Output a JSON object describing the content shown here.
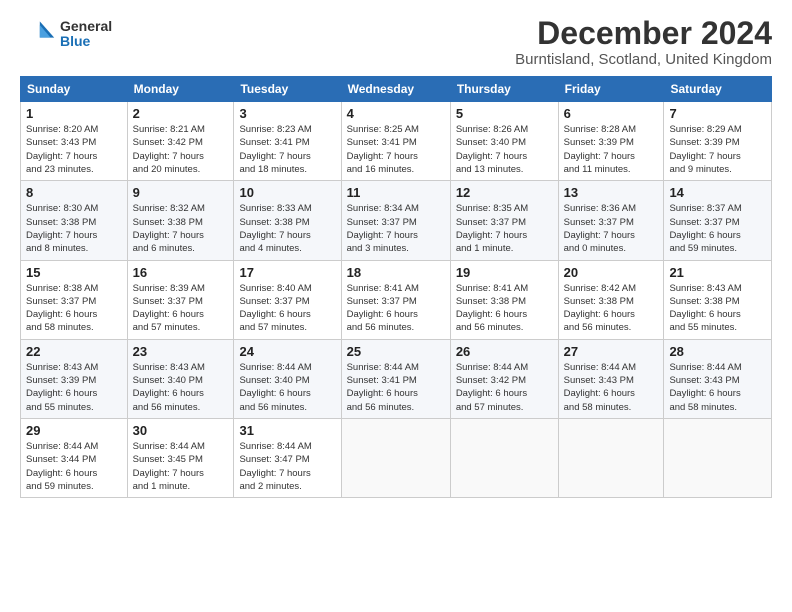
{
  "logo": {
    "general": "General",
    "blue": "Blue"
  },
  "title": "December 2024",
  "subtitle": "Burntisland, Scotland, United Kingdom",
  "headers": [
    "Sunday",
    "Monday",
    "Tuesday",
    "Wednesday",
    "Thursday",
    "Friday",
    "Saturday"
  ],
  "weeks": [
    [
      {
        "day": "1",
        "info": "Sunrise: 8:20 AM\nSunset: 3:43 PM\nDaylight: 7 hours\nand 23 minutes."
      },
      {
        "day": "2",
        "info": "Sunrise: 8:21 AM\nSunset: 3:42 PM\nDaylight: 7 hours\nand 20 minutes."
      },
      {
        "day": "3",
        "info": "Sunrise: 8:23 AM\nSunset: 3:41 PM\nDaylight: 7 hours\nand 18 minutes."
      },
      {
        "day": "4",
        "info": "Sunrise: 8:25 AM\nSunset: 3:41 PM\nDaylight: 7 hours\nand 16 minutes."
      },
      {
        "day": "5",
        "info": "Sunrise: 8:26 AM\nSunset: 3:40 PM\nDaylight: 7 hours\nand 13 minutes."
      },
      {
        "day": "6",
        "info": "Sunrise: 8:28 AM\nSunset: 3:39 PM\nDaylight: 7 hours\nand 11 minutes."
      },
      {
        "day": "7",
        "info": "Sunrise: 8:29 AM\nSunset: 3:39 PM\nDaylight: 7 hours\nand 9 minutes."
      }
    ],
    [
      {
        "day": "8",
        "info": "Sunrise: 8:30 AM\nSunset: 3:38 PM\nDaylight: 7 hours\nand 8 minutes."
      },
      {
        "day": "9",
        "info": "Sunrise: 8:32 AM\nSunset: 3:38 PM\nDaylight: 7 hours\nand 6 minutes."
      },
      {
        "day": "10",
        "info": "Sunrise: 8:33 AM\nSunset: 3:38 PM\nDaylight: 7 hours\nand 4 minutes."
      },
      {
        "day": "11",
        "info": "Sunrise: 8:34 AM\nSunset: 3:37 PM\nDaylight: 7 hours\nand 3 minutes."
      },
      {
        "day": "12",
        "info": "Sunrise: 8:35 AM\nSunset: 3:37 PM\nDaylight: 7 hours\nand 1 minute."
      },
      {
        "day": "13",
        "info": "Sunrise: 8:36 AM\nSunset: 3:37 PM\nDaylight: 7 hours\nand 0 minutes."
      },
      {
        "day": "14",
        "info": "Sunrise: 8:37 AM\nSunset: 3:37 PM\nDaylight: 6 hours\nand 59 minutes."
      }
    ],
    [
      {
        "day": "15",
        "info": "Sunrise: 8:38 AM\nSunset: 3:37 PM\nDaylight: 6 hours\nand 58 minutes."
      },
      {
        "day": "16",
        "info": "Sunrise: 8:39 AM\nSunset: 3:37 PM\nDaylight: 6 hours\nand 57 minutes."
      },
      {
        "day": "17",
        "info": "Sunrise: 8:40 AM\nSunset: 3:37 PM\nDaylight: 6 hours\nand 57 minutes."
      },
      {
        "day": "18",
        "info": "Sunrise: 8:41 AM\nSunset: 3:37 PM\nDaylight: 6 hours\nand 56 minutes."
      },
      {
        "day": "19",
        "info": "Sunrise: 8:41 AM\nSunset: 3:38 PM\nDaylight: 6 hours\nand 56 minutes."
      },
      {
        "day": "20",
        "info": "Sunrise: 8:42 AM\nSunset: 3:38 PM\nDaylight: 6 hours\nand 56 minutes."
      },
      {
        "day": "21",
        "info": "Sunrise: 8:43 AM\nSunset: 3:38 PM\nDaylight: 6 hours\nand 55 minutes."
      }
    ],
    [
      {
        "day": "22",
        "info": "Sunrise: 8:43 AM\nSunset: 3:39 PM\nDaylight: 6 hours\nand 55 minutes."
      },
      {
        "day": "23",
        "info": "Sunrise: 8:43 AM\nSunset: 3:40 PM\nDaylight: 6 hours\nand 56 minutes."
      },
      {
        "day": "24",
        "info": "Sunrise: 8:44 AM\nSunset: 3:40 PM\nDaylight: 6 hours\nand 56 minutes."
      },
      {
        "day": "25",
        "info": "Sunrise: 8:44 AM\nSunset: 3:41 PM\nDaylight: 6 hours\nand 56 minutes."
      },
      {
        "day": "26",
        "info": "Sunrise: 8:44 AM\nSunset: 3:42 PM\nDaylight: 6 hours\nand 57 minutes."
      },
      {
        "day": "27",
        "info": "Sunrise: 8:44 AM\nSunset: 3:43 PM\nDaylight: 6 hours\nand 58 minutes."
      },
      {
        "day": "28",
        "info": "Sunrise: 8:44 AM\nSunset: 3:43 PM\nDaylight: 6 hours\nand 58 minutes."
      }
    ],
    [
      {
        "day": "29",
        "info": "Sunrise: 8:44 AM\nSunset: 3:44 PM\nDaylight: 6 hours\nand 59 minutes."
      },
      {
        "day": "30",
        "info": "Sunrise: 8:44 AM\nSunset: 3:45 PM\nDaylight: 7 hours\nand 1 minute."
      },
      {
        "day": "31",
        "info": "Sunrise: 8:44 AM\nSunset: 3:47 PM\nDaylight: 7 hours\nand 2 minutes."
      },
      {
        "day": "",
        "info": ""
      },
      {
        "day": "",
        "info": ""
      },
      {
        "day": "",
        "info": ""
      },
      {
        "day": "",
        "info": ""
      }
    ]
  ]
}
